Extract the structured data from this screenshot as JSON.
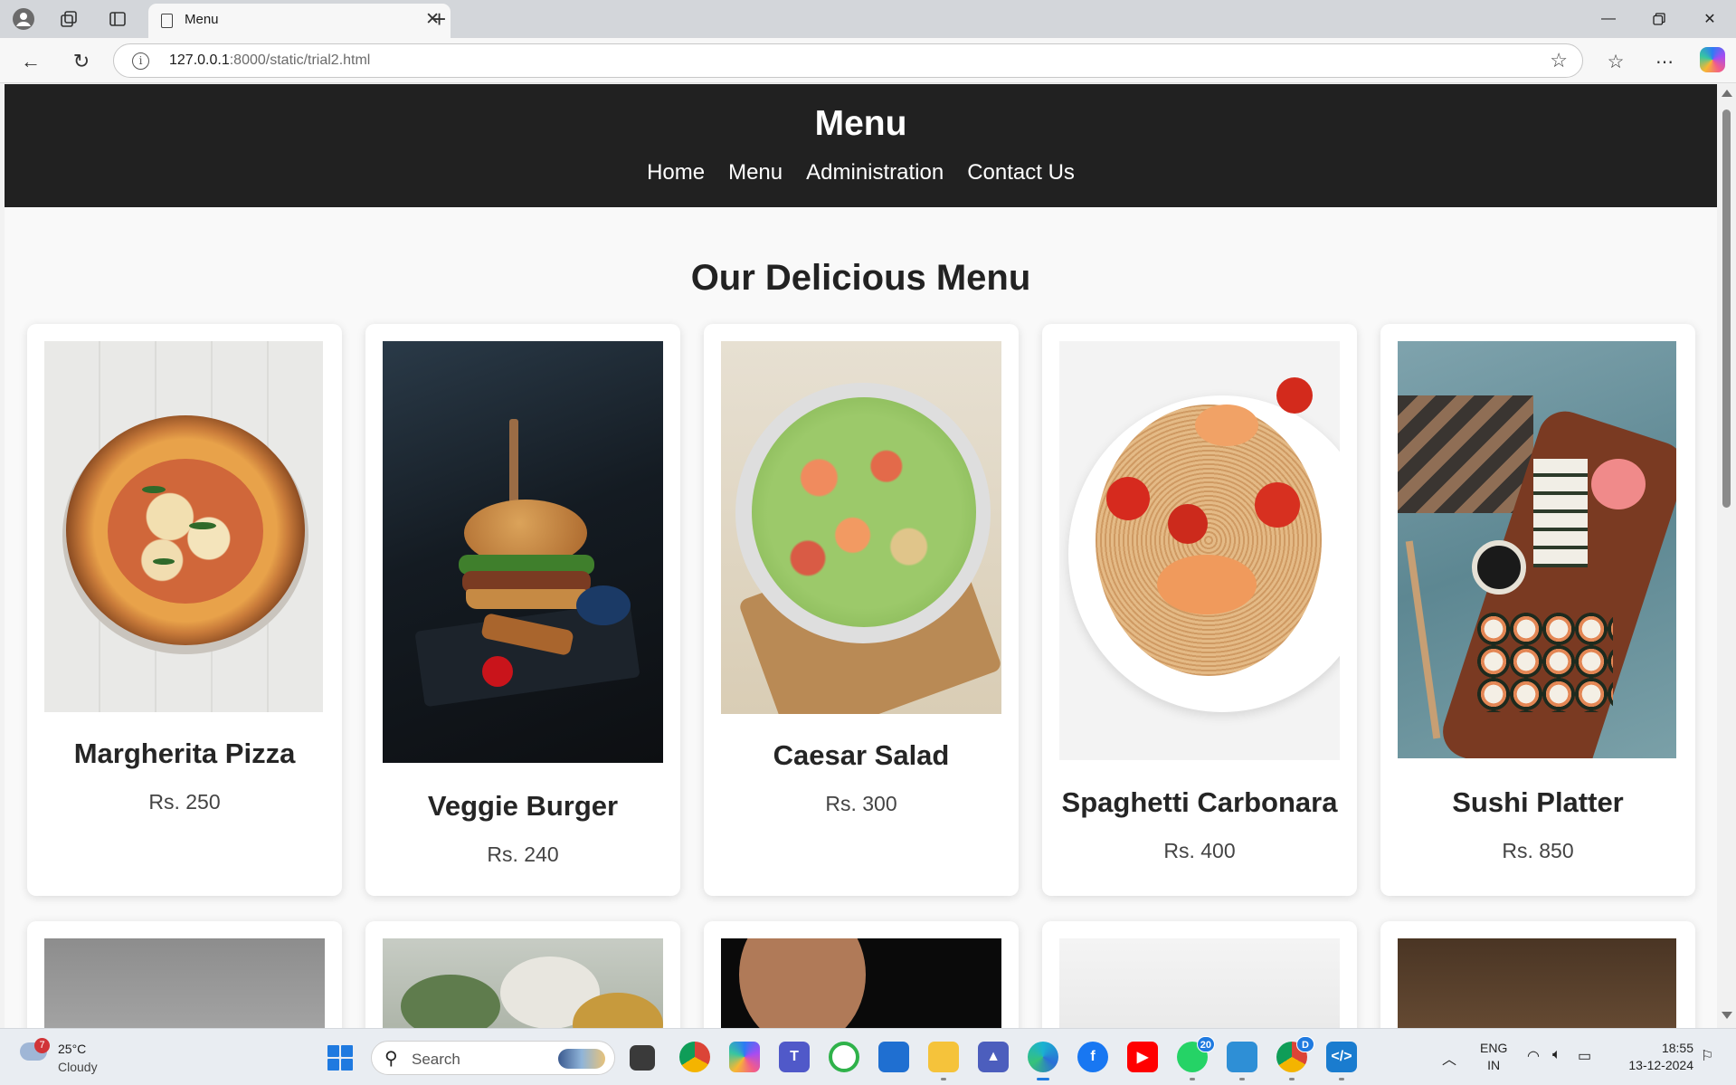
{
  "browser": {
    "tab_title": "Menu",
    "url_host": "127.0.0.1",
    "url_rest": ":8000/static/trial2.html"
  },
  "site": {
    "title": "Menu",
    "nav": [
      "Home",
      "Menu",
      "Administration",
      "Contact Us"
    ]
  },
  "page": {
    "heading": "Our Delicious Menu",
    "items": [
      {
        "name": "Margherita Pizza",
        "price": "Rs. 250"
      },
      {
        "name": "Veggie Burger",
        "price": "Rs. 240"
      },
      {
        "name": "Caesar Salad",
        "price": "Rs. 300"
      },
      {
        "name": "Spaghetti Carbonara",
        "price": "Rs. 400"
      },
      {
        "name": "Sushi Platter",
        "price": "Rs. 850"
      }
    ]
  },
  "taskbar": {
    "weather_temp": "25°C",
    "weather_condition": "Cloudy",
    "weather_badge": "7",
    "search_placeholder": "Search",
    "whatsapp_badge": "20",
    "chrome_badge": "D",
    "lang_line1": "ENG",
    "lang_line2": "IN",
    "time": "18:55",
    "date": "13-12-2024"
  },
  "colors": {
    "header_bg": "#212121",
    "page_bg": "#f9f9f9",
    "card_bg": "#ffffff",
    "accent": "#1f7ae0"
  }
}
